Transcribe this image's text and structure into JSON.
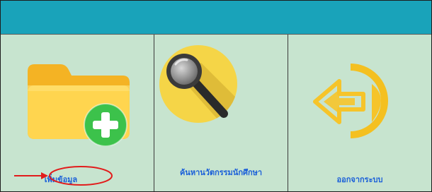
{
  "menu": {
    "items": [
      {
        "label": "เพิ่มข้อมูล",
        "icon": "folder-add-icon"
      },
      {
        "label": "ค้นหานวัตกรรมนักศึกษา",
        "icon": "magnifier-icon"
      },
      {
        "label": "ออกจากระบบ",
        "icon": "logout-arrow-icon"
      }
    ]
  },
  "colors": {
    "header": "#19a3ba",
    "panel": "#c7e4cf",
    "label": "#1a5fd9",
    "annotation": "#e21b1b"
  }
}
